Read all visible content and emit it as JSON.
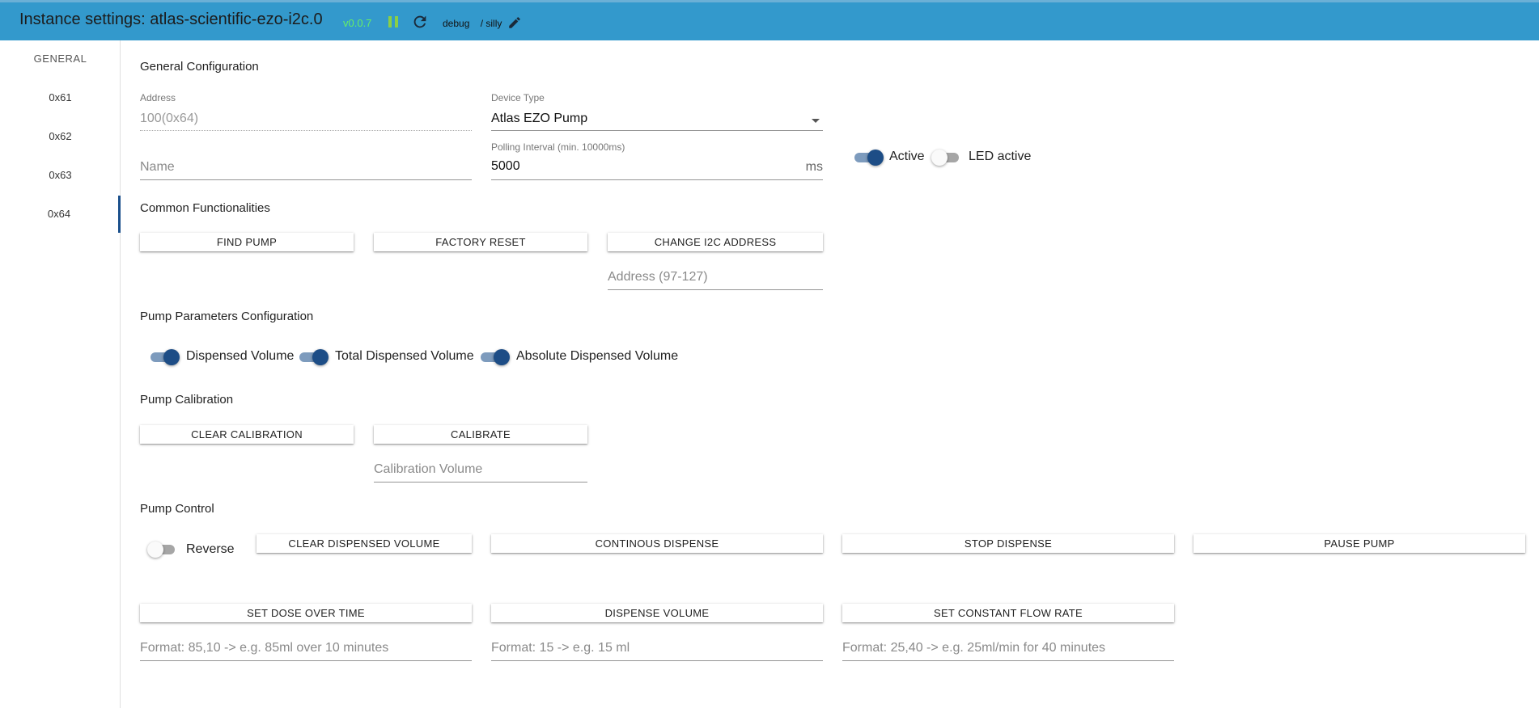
{
  "header": {
    "title": "Instance settings: atlas-scientific-ezo-i2c.0",
    "version": "v0.0.7",
    "log_level": "debug",
    "log_level_suffix": "/ silly",
    "pause_icon": "pause-icon",
    "refresh_icon": "refresh-icon",
    "edit_icon": "pencil-icon"
  },
  "sidebar": {
    "items": [
      {
        "label": "GENERAL"
      },
      {
        "label": "0x61"
      },
      {
        "label": "0x62"
      },
      {
        "label": "0x63"
      },
      {
        "label": "0x64"
      }
    ],
    "active_item": "0x64"
  },
  "general_config": {
    "title": "General Configuration",
    "address": {
      "label": "Address",
      "value": "100(0x64)"
    },
    "device_type": {
      "label": "Device Type",
      "value": "Atlas EZO Pump"
    },
    "name": {
      "placeholder": "Name",
      "value": ""
    },
    "polling_interval": {
      "label": "Polling Interval (min. 10000ms)",
      "value": "5000",
      "unit": "ms"
    },
    "active": {
      "label": "Active",
      "checked": true
    },
    "led_active": {
      "label": "LED active",
      "checked": false
    }
  },
  "common_functionalities": {
    "title": "Common Functionalities",
    "find_pump": "FIND PUMP",
    "factory_reset": "FACTORY RESET",
    "change_i2c_address": "CHANGE I2C ADDRESS",
    "address_input": {
      "placeholder": "Address (97-127)"
    }
  },
  "pump_parameters": {
    "title": "Pump Parameters Configuration",
    "dispensed_volume": {
      "label": "Dispensed Volume",
      "checked": true
    },
    "total_dispensed_volume": {
      "label": "Total Dispensed Volume",
      "checked": true
    },
    "absolute_dispensed_volume": {
      "label": "Absolute Dispensed Volume",
      "checked": true
    }
  },
  "pump_calibration": {
    "title": "Pump Calibration",
    "clear_calibration": "CLEAR CALIBRATION",
    "calibrate": "CALIBRATE",
    "calibration_volume": {
      "placeholder": "Calibration Volume"
    }
  },
  "pump_control": {
    "title": "Pump Control",
    "reverse": {
      "label": "Reverse",
      "checked": false
    },
    "clear_dispensed_volume": "CLEAR DISPENSED VOLUME",
    "continous_dispense": "CONTINOUS DISPENSE",
    "stop_dispense": "STOP DISPENSE",
    "pause_pump": "PAUSE PUMP",
    "set_dose_over_time": "SET DOSE OVER TIME",
    "dispense_volume": "DISPENSE VOLUME",
    "set_constant_flow_rate": "SET CONSTANT FLOW RATE",
    "dose_input": {
      "placeholder": "Format: 85,10 -> e.g. 85ml over 10 minutes"
    },
    "volume_input": {
      "placeholder": "Format: 15 -> e.g. 15 ml"
    },
    "flow_input": {
      "placeholder": "Format: 25,40 -> e.g. 25ml/min for 40 minutes"
    }
  },
  "colors": {
    "header_bg": "#3399cc",
    "switch_on_thumb": "#1d4d86",
    "switch_on_track": "#7d9bbd",
    "version_text": "#66ee66"
  }
}
